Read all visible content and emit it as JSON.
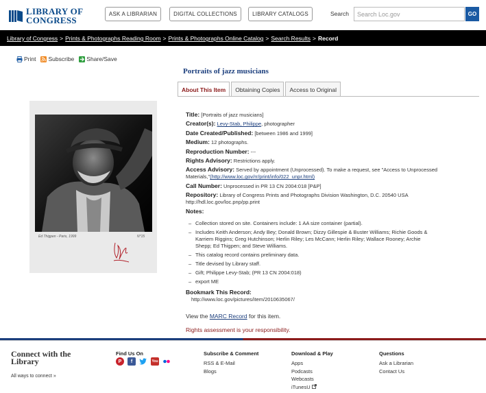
{
  "header": {
    "logo_line1": "LIBRARY OF",
    "logo_line2": "CONGRESS",
    "nav_buttons": [
      "ASK A LIBRARIAN",
      "DIGITAL COLLECTIONS",
      "LIBRARY CATALOGS"
    ],
    "search_label": "Search",
    "search_placeholder": "Search Loc.gov",
    "go_label": "GO"
  },
  "breadcrumb": {
    "items": [
      "Library of Congress",
      "Prints & Photographs Reading Room",
      "Prints & Photographs Online Catalog",
      "Search Results"
    ],
    "current": "Record",
    "separator": ">"
  },
  "tools": {
    "print": "Print",
    "subscribe": "Subscribe",
    "share": "Share/Save"
  },
  "page_title": "Portraits of jazz musicians",
  "tabs": [
    "About This Item",
    "Obtaining Copies",
    "Access to Original"
  ],
  "photo": {
    "caption_left": "Ed Thigpen - Paris, 1999",
    "caption_right": "N°15"
  },
  "record": {
    "title_label": "Title:",
    "title_value": "[Portraits of jazz musicians]",
    "creator_label": "Creator(s):",
    "creator_link": "Levy-Stab, Philippe",
    "creator_suffix": ", photographer",
    "date_label": "Date Created/Published:",
    "date_value": "[between 1986 and 1999]",
    "medium_label": "Medium:",
    "medium_value": "12 photographs.",
    "repro_label": "Reproduction Number:",
    "repro_value": "---",
    "rights_label": "Rights Advisory:",
    "rights_value": "Restrictions apply.",
    "access_label": "Access Advisory:",
    "access_value": "Served by appointment (Unprocessed). To make a request, see \"Access to Unprocessed Materials,\"",
    "access_link": "(http://www.loc.gov/rr/print/info/022_unpr.html)",
    "call_label": "Call Number:",
    "call_value": "Unprocessed in PR 13 CN 2004:018 [P&P]",
    "repo_label": "Repository:",
    "repo_value": "Library of Congress Prints and Photographs Division Washington, D.C. 20540 USA http://hdl.loc.gov/loc.pnp/pp.print",
    "notes_label": "Notes:",
    "notes": [
      "Collection stored on site. Containers include: 1 AA size container (partial).",
      "Includes Keith Anderson; Andy Bey; Donald Brown; Dizzy Gillespie & Buster Williams; Richie Goods & Karriem Riggins; Greg Hutchinson; Herlin Riley; Les McCann; Herlin Riley; Wallace Rooney; Archie Shepp; Ed Thigpen; and Steve Williams.",
      "This catalog record contains preliminary data.",
      "Title devised by Library staff.",
      "Gift; Philippe Levy-Stab; (PR 13 CN 2004:018)",
      "export ME"
    ]
  },
  "bookmark": {
    "label": "Bookmark This Record:",
    "url": "http://www.loc.gov/pictures/item/2010635067/"
  },
  "marc": {
    "prefix": "View the ",
    "link": "MARC Record",
    "suffix": " for this item."
  },
  "rights_assessment": "Rights assessment is your responsibility.",
  "footer": {
    "connect_title": "Connect with the Library",
    "connect_link": "All ways to connect »",
    "find_us": "Find Us On",
    "subscribe_heading": "Subscribe & Comment",
    "subscribe_items": [
      "RSS & E-Mail",
      "Blogs"
    ],
    "download_heading": "Download & Play",
    "download_items": [
      "Apps",
      "Podcasts",
      "Webcasts",
      "iTunesU"
    ],
    "questions_heading": "Questions",
    "questions_items": [
      "Ask a Librarian",
      "Contact Us"
    ]
  },
  "colors": {
    "brand_blue": "#0a4a8a",
    "title_blue": "#1a3d7c",
    "accent_red": "#8b1a1a",
    "breadcrumb_bg": "#000000"
  }
}
